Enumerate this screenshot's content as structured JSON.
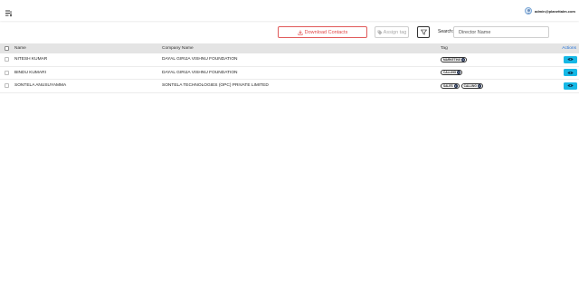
{
  "header": {
    "user_email": "admin@planettalm.com"
  },
  "toolbar": {
    "download_label": "Download Contacts",
    "assign_label": "Assign tag",
    "search_label": "Search:",
    "search_placeholder": "Director Name",
    "search_value": ""
  },
  "table": {
    "columns": {
      "name": "Name",
      "company": "Company Name",
      "tag": "Tag",
      "actions": "Actions"
    },
    "rows": [
      {
        "name": "NITESH KUMAR",
        "company": "DAYAL GIRIJA VISHNU FOUNDATION",
        "tags": [
          "MARKETING"
        ]
      },
      {
        "name": "BINDU KUMARI",
        "company": "DAYAL GIRIJA VISHNU FOUNDATION",
        "tags": [
          "CALLING"
        ]
      },
      {
        "name": "SONTELA ANUSUYAMMA",
        "company": "SONTELA TECHNOLOGIES (OPC) PRIVATE LIMITED",
        "tags": [
          "SALES",
          "CALLING"
        ]
      }
    ]
  },
  "icons": {
    "menu": "menu-lines-icon",
    "avatar": "user-avatar-icon",
    "download": "download-icon",
    "tag": "tag-icon",
    "filter": "filter-funnel-icon",
    "remove": "remove-circle-icon",
    "view": "eye-icon"
  },
  "colors": {
    "download_accent": "#e04848",
    "view_button": "#16b8e6",
    "actions_header": "#1f6fd6",
    "table_header_bg": "#e4e4e4"
  }
}
